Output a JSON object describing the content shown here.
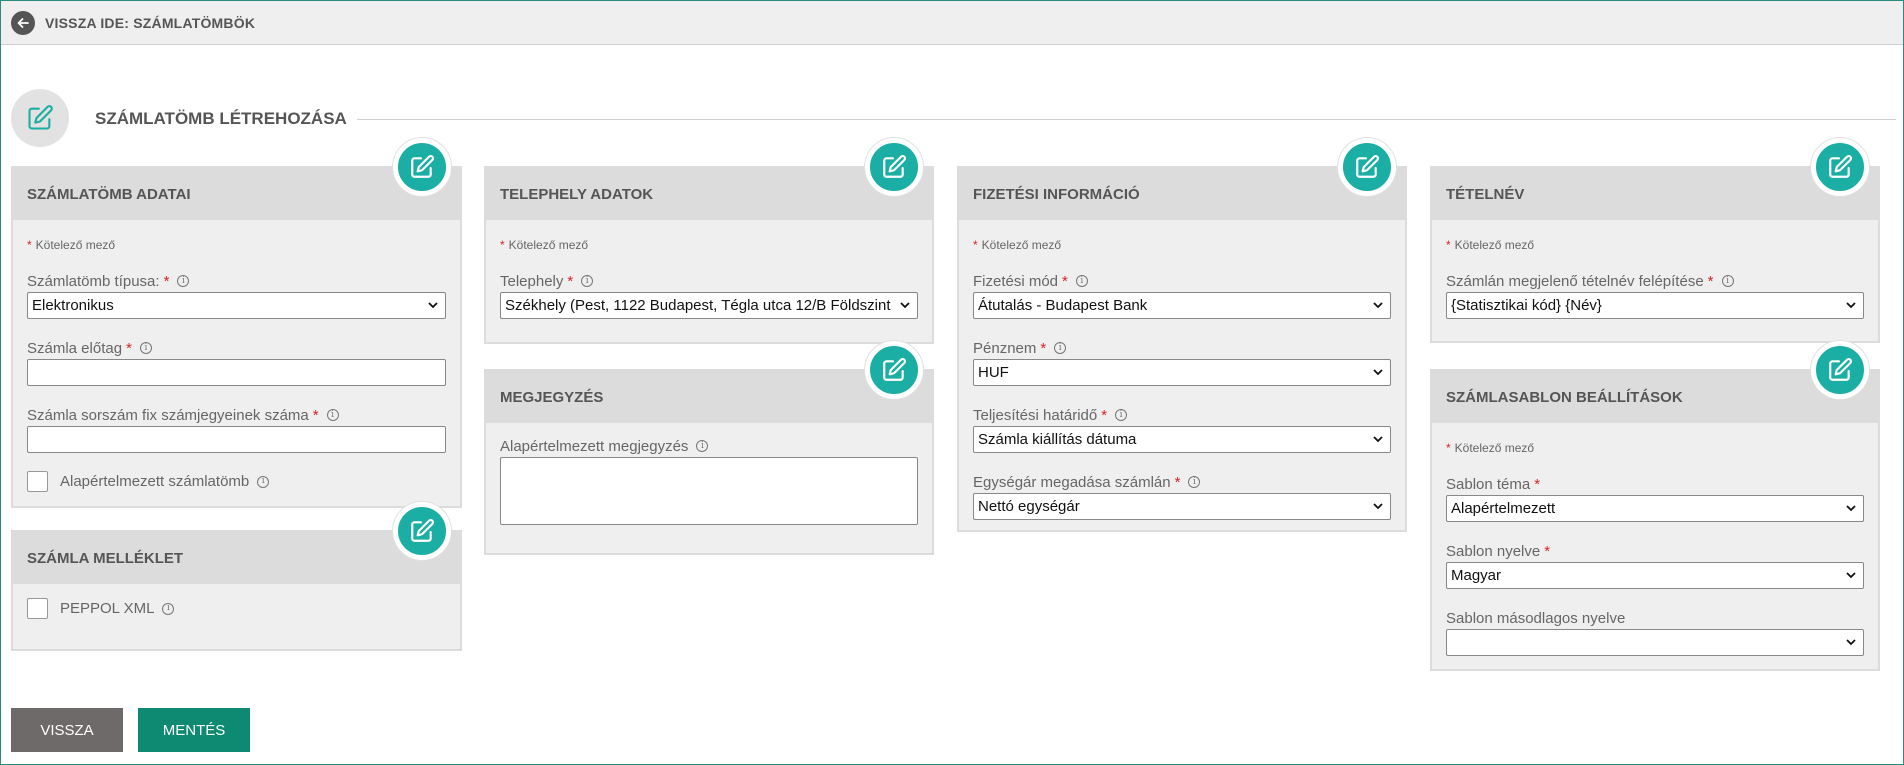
{
  "topbar": {
    "back_label": "VISSZA IDE: SZÁMLATÖMBÖK"
  },
  "page": {
    "title": "SZÁMLATÖMB LÉTREHOZÁSA"
  },
  "required_note": "Kötelező mező",
  "panels": {
    "szamlatomb": {
      "title": "SZÁMLATÖMB ADATAI",
      "type_label": "Számlatömb típusa:",
      "type_value": "Elektronikus",
      "prefix_label": "Számla előtag",
      "prefix_value": "",
      "digits_label": "Számla sorszám fix számjegyeinek száma",
      "digits_value": "",
      "default_label": "Alapértelmezett számlatömb"
    },
    "melleklet": {
      "title": "SZÁMLA MELLÉKLET",
      "peppol_label": "PEPPOL XML"
    },
    "telephely": {
      "title": "TELEPHELY ADATOK",
      "site_label": "Telephely",
      "site_value": "Székhely (Pest, 1122 Budapest, Tégla utca 12/B Földszint"
    },
    "megjegyzes": {
      "title": "MEGJEGYZÉS",
      "note_label": "Alapértelmezett megjegyzés",
      "note_value": ""
    },
    "fizetes": {
      "title": "FIZETÉSI INFORMÁCIÓ",
      "method_label": "Fizetési mód",
      "method_value": "Átutalás - Budapest Bank",
      "currency_label": "Pénznem",
      "currency_value": "HUF",
      "deadline_label": "Teljesítési határidő",
      "deadline_value": "Számla kiállítás dátuma",
      "unitprice_label": "Egységár megadása számlán",
      "unitprice_value": "Nettó egységár"
    },
    "tetelnev": {
      "title": "TÉTELNÉV",
      "structure_label": "Számlán megjelenő tételnév felépítése",
      "structure_value": "{Statisztikai kód} {Név}"
    },
    "sablon": {
      "title": "SZÁMLASABLON BEÁLLÍTÁSOK",
      "theme_label": "Sablon téma",
      "theme_value": "Alapértelmezett",
      "lang_label": "Sablon nyelve",
      "lang_value": "Magyar",
      "second_lang_label": "Sablon másodlagos nyelve",
      "second_lang_value": ""
    }
  },
  "buttons": {
    "back": "VISSZA",
    "save": "MENTÉS"
  },
  "colors": {
    "accent": "#1aaea5",
    "save": "#0f8a72",
    "back": "#6f6a6a",
    "required": "#dd2222"
  },
  "icons": {
    "back": "arrow-left-icon",
    "edit": "pencil-square-icon",
    "info": "info-icon",
    "dropdown": "chevron-down-icon"
  }
}
